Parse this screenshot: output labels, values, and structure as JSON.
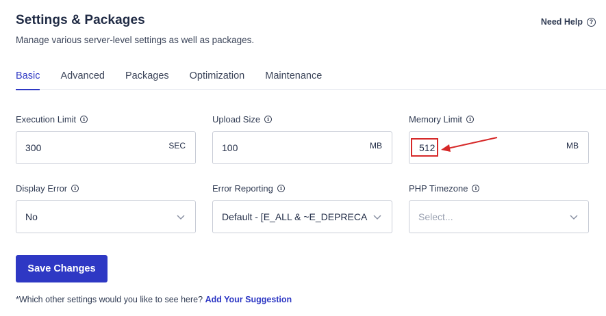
{
  "header": {
    "title": "Settings & Packages",
    "subtitle": "Manage various server-level settings as well as packages.",
    "help_label": "Need Help",
    "help_icon": "question-circle-icon"
  },
  "tabs": [
    {
      "label": "Basic",
      "active": true
    },
    {
      "label": "Advanced",
      "active": false
    },
    {
      "label": "Packages",
      "active": false
    },
    {
      "label": "Optimization",
      "active": false
    },
    {
      "label": "Maintenance",
      "active": false
    }
  ],
  "fields": {
    "execution_limit": {
      "label": "Execution Limit",
      "value": "300",
      "unit": "SEC"
    },
    "upload_size": {
      "label": "Upload Size",
      "value": "100",
      "unit": "MB"
    },
    "memory_limit": {
      "label": "Memory Limit",
      "value": "512",
      "unit": "MB"
    },
    "display_error": {
      "label": "Display Error",
      "value": "No"
    },
    "error_reporting": {
      "label": "Error Reporting",
      "value": "Default - [E_ALL & ~E_DEPRECA"
    },
    "php_timezone": {
      "label": "PHP Timezone",
      "placeholder": "Select..."
    }
  },
  "actions": {
    "save_label": "Save Changes"
  },
  "footer": {
    "text": "*Which other settings would you like to see here?",
    "link": "Add Your Suggestion"
  },
  "colors": {
    "accent": "#2e38c4",
    "annotation": "#d62828",
    "text": "#1f2a44"
  }
}
